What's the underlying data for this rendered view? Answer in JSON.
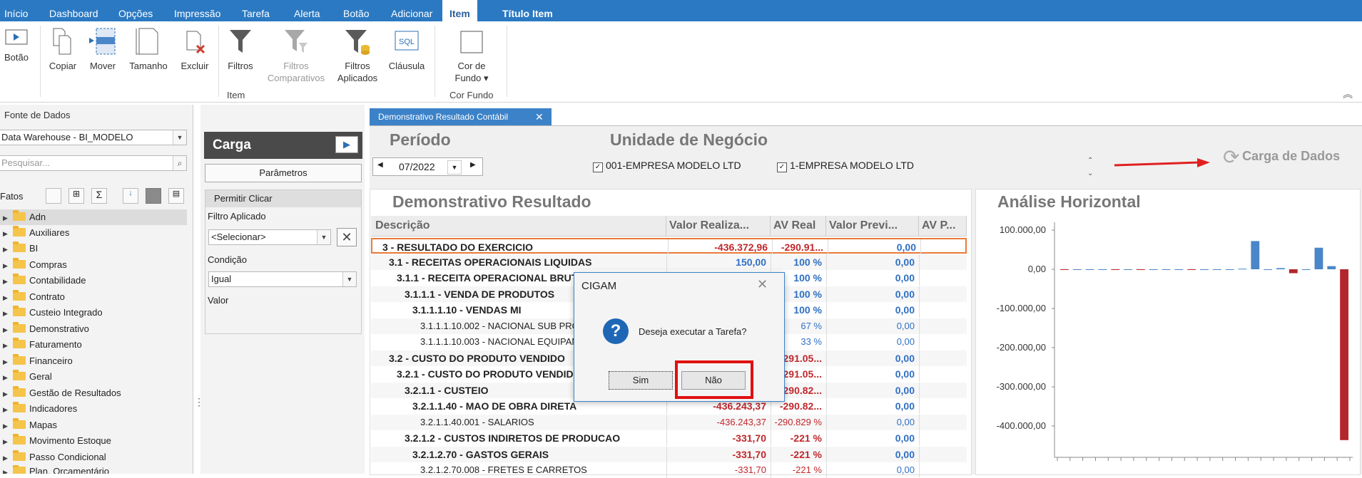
{
  "menu": {
    "items": [
      "Início",
      "Dashboard",
      "Opções",
      "Impressão",
      "Tarefa",
      "Alerta",
      "Botão",
      "Adicionar",
      "Item",
      "Título Item"
    ],
    "active": "Item"
  },
  "ribbon": {
    "buttons": {
      "botao": "Botão",
      "copiar": "Copiar",
      "mover": "Mover",
      "tamanho": "Tamanho",
      "excluir": "Excluir",
      "filtros": "Filtros",
      "filtros_comp_1": "Filtros",
      "filtros_comp_2": "Comparativos",
      "filtros_apl_1": "Filtros",
      "filtros_apl_2": "Aplicados",
      "clausula": "Cláusula",
      "cor_fundo_1": "Cor de",
      "cor_fundo_2": "Fundo ▾"
    },
    "groups": {
      "item": "Item",
      "cor_fundo": "Cor Fundo"
    },
    "sql_icon_text": "SQL"
  },
  "left": {
    "title": "Fonte de Dados",
    "source": "Data Warehouse - BI_MODELO",
    "search_placeholder": "Pesquisar...",
    "facts_label": "Fatos",
    "tree": [
      "Adn",
      "Auxiliares",
      "BI",
      "Compras",
      "Contabilidade",
      "Contrato",
      "Custeio Integrado",
      "Demonstrativo",
      "Faturamento",
      "Financeiro",
      "Geral",
      "Gestão de Resultados",
      "Indicadores",
      "Mapas",
      "Movimento Estoque",
      "Passo Condicional",
      "Plan. Orçamentário"
    ]
  },
  "middle": {
    "header": "Carga",
    "params_button": "Parâmetros",
    "permit_click": "Permitir Clicar",
    "filter_label": "Filtro Aplicado",
    "filter_value": "<Selecionar>",
    "condition_label": "Condição",
    "condition_value": "Igual",
    "value_label": "Valor"
  },
  "document": {
    "tab": "Demonstrativo Resultado Contábil",
    "periodo_title": "Período",
    "period_value": "07/2022",
    "unidade_title": "Unidade de Negócio",
    "units": [
      "001-EMPRESA MODELO LTD",
      "1-EMPRESA MODELO LTD"
    ],
    "carga_dados": "Carga de Dados",
    "demo_title": "Demonstrativo Resultado",
    "analise_title": "Análise Horizontal"
  },
  "grid": {
    "headers": [
      "Descrição",
      "Valor Realiza...",
      "AV Real",
      "Valor Previ...",
      "AV P..."
    ],
    "rows": [
      {
        "desc": "3 - RESULTADO DO EXERCICIO",
        "indent": 0,
        "bold": true,
        "v1": "-436.372,96",
        "v2": "-290.91...",
        "v3": "0,00",
        "c1": "red",
        "c2": "red"
      },
      {
        "desc": "3.1 - RECEITAS OPERACIONAIS LIQUIDAS",
        "indent": 1,
        "bold": true,
        "v1": "150,00",
        "v2": "100 %",
        "v3": "0,00",
        "c1": "blue",
        "c2": "blue"
      },
      {
        "desc": "3.1.1 - RECEITA OPERACIONAL BRUTA",
        "indent": 2,
        "bold": true,
        "v1": "",
        "v2": "100 %",
        "v3": "0,00",
        "c1": "blue",
        "c2": "blue"
      },
      {
        "desc": "3.1.1.1 - VENDA DE PRODUTOS",
        "indent": 3,
        "bold": true,
        "v1": "",
        "v2": "100 %",
        "v3": "0,00",
        "c1": "blue",
        "c2": "blue"
      },
      {
        "desc": "3.1.1.1.10 - VENDAS MI",
        "indent": 4,
        "bold": true,
        "v1": "",
        "v2": "100 %",
        "v3": "0,00",
        "c1": "blue",
        "c2": "blue"
      },
      {
        "desc": "3.1.1.1.10.002 - NACIONAL SUB PRODUTOS",
        "indent": 5,
        "bold": false,
        "v1": "",
        "v2": "67 %",
        "v3": "0,00",
        "c1": "blue",
        "c2": "blue"
      },
      {
        "desc": "3.1.1.1.10.003 - NACIONAL EQUIPAMENTOS",
        "indent": 5,
        "bold": false,
        "v1": "",
        "v2": "33 %",
        "v3": "0,00",
        "c1": "blue",
        "c2": "blue"
      },
      {
        "desc": "3.2 - CUSTO DO PRODUTO VENDIDO",
        "indent": 1,
        "bold": true,
        "v1": "",
        "v2": "-291.05...",
        "v3": "0,00",
        "c1": "red",
        "c2": "red"
      },
      {
        "desc": "3.2.1 - CUSTO DO PRODUTO VENDIDO",
        "indent": 2,
        "bold": true,
        "v1": "",
        "v2": "-291.05...",
        "v3": "0,00",
        "c1": "red",
        "c2": "red"
      },
      {
        "desc": "3.2.1.1 - CUSTEIO",
        "indent": 3,
        "bold": true,
        "v1": "",
        "v2": "-290.82...",
        "v3": "0,00",
        "c1": "red",
        "c2": "red"
      },
      {
        "desc": "3.2.1.1.40 - MAO DE OBRA DIRETA",
        "indent": 4,
        "bold": true,
        "v1": "-436.243,37",
        "v2": "-290.82...",
        "v3": "0,00",
        "c1": "red",
        "c2": "red"
      },
      {
        "desc": "3.2.1.1.40.001 - SALARIOS",
        "indent": 5,
        "bold": false,
        "v1": "-436.243,37",
        "v2": "-290.829 %",
        "v3": "0,00",
        "c1": "red",
        "c2": "red"
      },
      {
        "desc": "3.2.1.2 - CUSTOS INDIRETOS DE PRODUCAO",
        "indent": 3,
        "bold": true,
        "v1": "-331,70",
        "v2": "-221 %",
        "v3": "0,00",
        "c1": "red",
        "c2": "red"
      },
      {
        "desc": "3.2.1.2.70 - GASTOS GERAIS",
        "indent": 4,
        "bold": true,
        "v1": "-331,70",
        "v2": "-221 %",
        "v3": "0,00",
        "c1": "red",
        "c2": "red"
      },
      {
        "desc": "3.2.1.2.70.008 - FRETES E CARRETOS",
        "indent": 5,
        "bold": false,
        "v1": "-331,70",
        "v2": "-221 %",
        "v3": "0,00",
        "c1": "red",
        "c2": "red"
      }
    ]
  },
  "dialog": {
    "title": "CIGAM",
    "message": "Deseja executar a Tarefa?",
    "yes": "Sim",
    "no": "Não"
  },
  "chart_data": {
    "type": "bar",
    "title": "Análise Horizontal",
    "ylim": [
      -480000,
      120000
    ],
    "yticks": [
      "100.000,00",
      "0,00",
      "-100.000,00",
      "-200.000,00",
      "-300.000,00",
      "-400.000,00"
    ],
    "ytick_values": [
      100000,
      0,
      -100000,
      -200000,
      -300000,
      -400000
    ],
    "values": [
      -300,
      0,
      0,
      0,
      -600,
      0,
      -500,
      0,
      0,
      0,
      -400,
      0,
      0,
      0,
      1500,
      72000,
      0,
      3000,
      -10000,
      0,
      55000,
      8000,
      -436000
    ],
    "positive_color": "#4a86c8",
    "negative_color": "#b3262c"
  }
}
